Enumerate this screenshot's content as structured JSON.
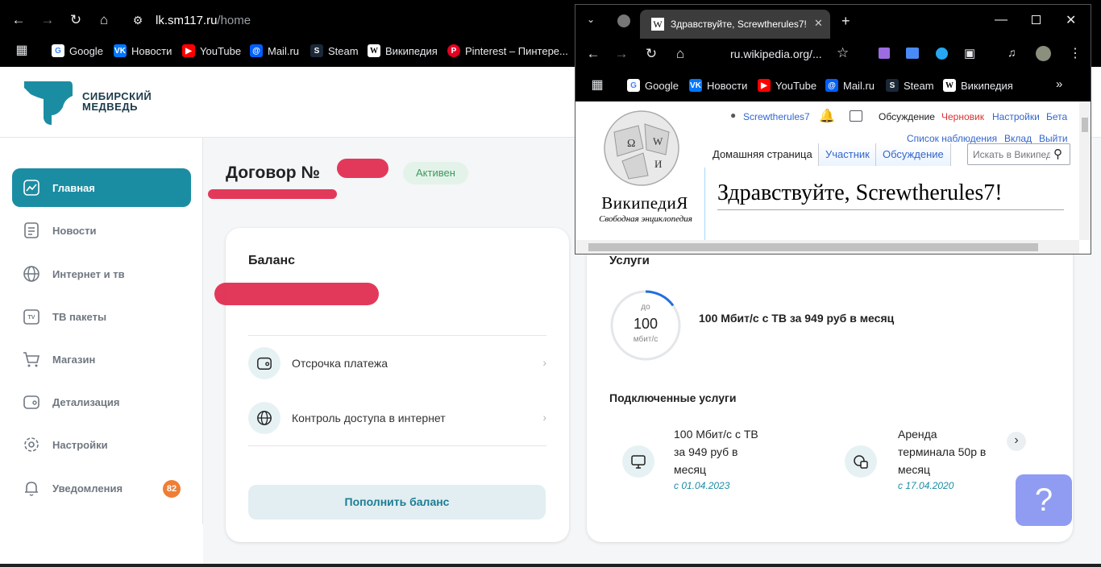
{
  "browser": {
    "url_host": "lk.sm117.ru",
    "url_path": "/home",
    "bookmarks": [
      {
        "label": "Google",
        "icon": "google-icon"
      },
      {
        "label": "Новости",
        "icon": "vk-icon"
      },
      {
        "label": "YouTube",
        "icon": "youtube-icon"
      },
      {
        "label": "Mail.ru",
        "icon": "mailru-icon"
      },
      {
        "label": "Steam",
        "icon": "steam-icon"
      },
      {
        "label": "Википедия",
        "icon": "wikipedia-icon"
      },
      {
        "label": "Pinterest – Пинтере...",
        "icon": "pinterest-icon"
      }
    ]
  },
  "brand": {
    "line1": "СИБИРСКИЙ",
    "line2": "МЕДВЕДЬ",
    "color": "#1b8da3"
  },
  "sidebar": {
    "items": [
      {
        "label": "Главная",
        "icon": "chart-icon",
        "active": true
      },
      {
        "label": "Новости",
        "icon": "document-icon"
      },
      {
        "label": "Интернет и тв",
        "icon": "globe-icon"
      },
      {
        "label": "ТВ пакеты",
        "icon": "tv-icon"
      },
      {
        "label": "Магазин",
        "icon": "cart-icon"
      },
      {
        "label": "Детализация",
        "icon": "wallet-icon"
      },
      {
        "label": "Настройки",
        "icon": "gear-icon"
      },
      {
        "label": "Уведомления",
        "icon": "bell-icon",
        "badge": "82"
      }
    ]
  },
  "contract": {
    "title": "Договор №",
    "status": "Активен"
  },
  "balance": {
    "title": "Баланс",
    "rows": [
      {
        "label": "Отсрочка платежа",
        "icon": "wallet-icon"
      },
      {
        "label": "Контроль доступа в интернет",
        "icon": "globe-icon"
      }
    ],
    "topup_label": "Пополнить баланс"
  },
  "services": {
    "title": "Услуги",
    "speed": {
      "prefix": "до",
      "value": "100",
      "unit": "мбит/с",
      "fill": 0.15
    },
    "tariff": "100 Мбит/с с ТВ за 949 руб в месяц",
    "connected_title": "Подключенные услуги",
    "connected": [
      {
        "line1": "100 Мбит/с с ТВ",
        "line2": "за 949 руб в",
        "line3": "месяц",
        "date": "с 01.04.2023",
        "icon": "monitor-icon"
      },
      {
        "line1": "Аренда",
        "line2": "терминала 50р в",
        "line3": "месяц",
        "date": "с 17.04.2020",
        "icon": "coins-icon"
      }
    ]
  },
  "help": {
    "label": "?"
  },
  "wiki_window": {
    "tab_title": "Здравствуйте, Screwtherules7!",
    "url": "ru.wikipedia.org/...",
    "bookmarks": [
      "Google",
      "Новости",
      "YouTube",
      "Mail.ru",
      "Steam",
      "Википедия"
    ],
    "user": "Screwtherules7",
    "top_links": [
      "Обсуждение",
      "Черновик",
      "Настройки",
      "Бета"
    ],
    "second_links": [
      "Список наблюдения",
      "Вклад",
      "Выйти"
    ],
    "logo_title": "ВикипедиЯ",
    "logo_subtitle": "Свободная энциклопедия",
    "tabs": [
      "Домашняя страница",
      "Участник",
      "Обсуждение"
    ],
    "search_placeholder": "Искать в Википедии",
    "heading": "Здравствуйте, Screwtherules7!"
  }
}
